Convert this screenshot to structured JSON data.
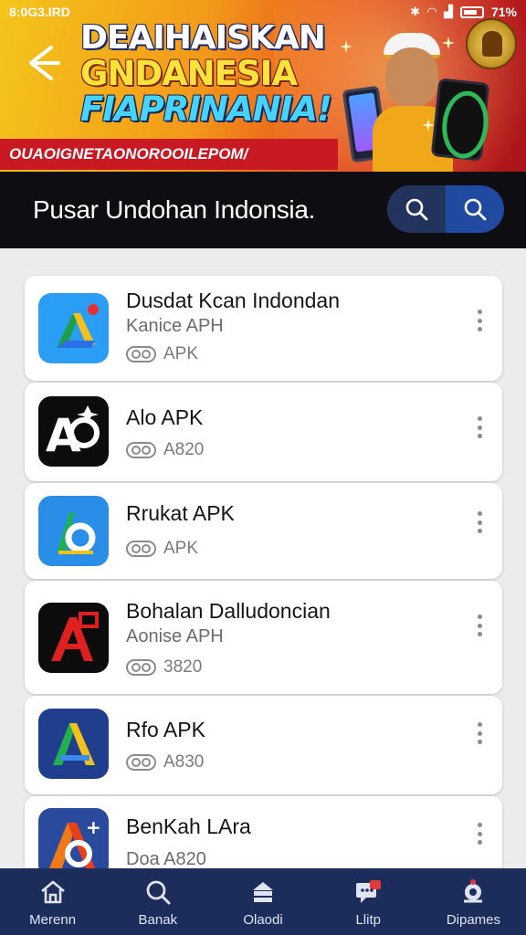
{
  "status_bar": {
    "left": "8:0G3.IRD",
    "right": "71%"
  },
  "banner": {
    "headline": [
      "DEAIHAISKAN",
      "GNDANESIA",
      "FIAPRINANIA!"
    ],
    "promo": "OUAOIGNETAONOROOILEPOM/"
  },
  "header": {
    "title": "Pusar Undohan Indonsia."
  },
  "apps": [
    {
      "name": "Dusdat Kcan Indondan",
      "sub": "Kanice APH",
      "meta": "APK",
      "icon": "google-drive-style-app-icon"
    },
    {
      "name": "Alo APK",
      "sub": "",
      "meta": "A820",
      "icon": "black-a-letter-app-icon"
    },
    {
      "name": "Rrukat APK",
      "sub": "",
      "meta": "APK",
      "icon": "blue-b-letter-app-icon"
    },
    {
      "name": "Bohalan Dalludoncian",
      "sub": "Aonise APH",
      "meta": "3820",
      "icon": "red-a-letter-app-icon"
    },
    {
      "name": "Rfo APK",
      "sub": "",
      "meta": "A830",
      "icon": "navy-a-letter-app-icon"
    },
    {
      "name": "BenKah LAra",
      "sub": "",
      "meta": "Doa A820",
      "icon": "gradient-a-letter-app-icon"
    }
  ],
  "nav": [
    {
      "label": "Merenn",
      "icon": "home-icon"
    },
    {
      "label": "Banak",
      "icon": "search-icon"
    },
    {
      "label": "Olaodi",
      "icon": "store-icon"
    },
    {
      "label": "Llitp",
      "icon": "chat-icon"
    },
    {
      "label": "Dipames",
      "icon": "profile-icon"
    }
  ],
  "colors": {
    "header_bg": "#0d0d12",
    "nav_bg": "#1c2d5c",
    "search_bg": "#1f4aa0",
    "promo_bg": "#c91a24"
  }
}
